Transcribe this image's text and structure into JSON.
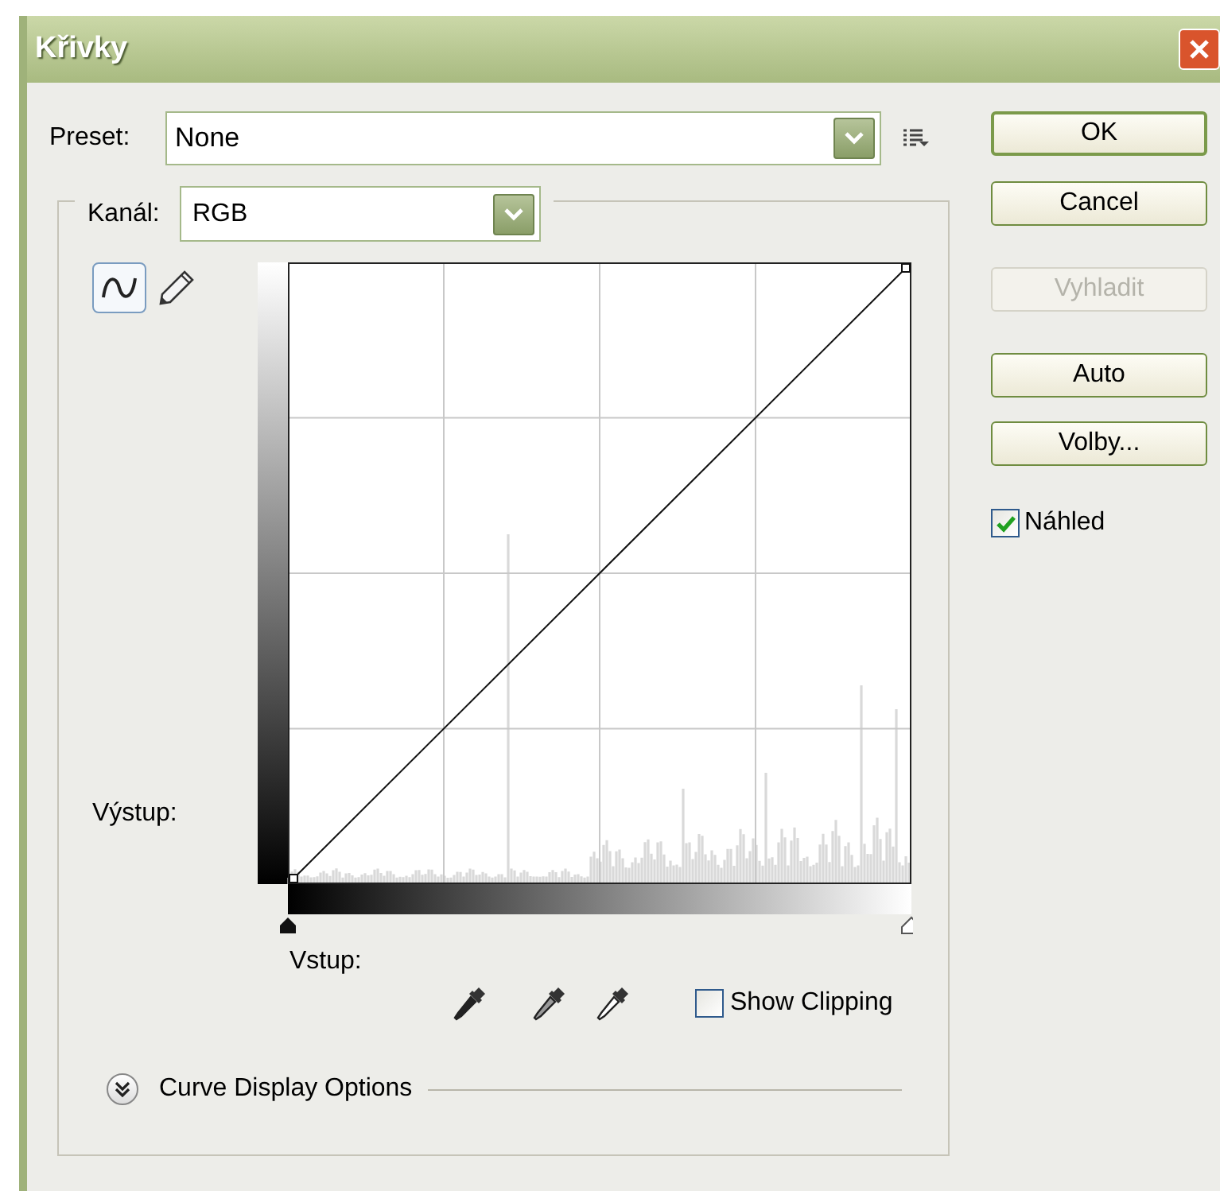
{
  "window": {
    "title": "Křivky"
  },
  "preset": {
    "label": "Preset:",
    "value": "None"
  },
  "buttons": [
    {
      "label": "OK",
      "disabled": false,
      "default": true
    },
    {
      "label": "Cancel",
      "disabled": false,
      "default": false
    },
    {
      "label": "Vyhladit",
      "disabled": true,
      "default": false
    },
    {
      "label": "Auto",
      "disabled": false,
      "default": false
    },
    {
      "label": "Volby...",
      "disabled": false,
      "default": false
    }
  ],
  "preview": {
    "label": "Náhled",
    "checked": true
  },
  "channel": {
    "label": "Kanál:",
    "value": "RGB"
  },
  "tools": [
    {
      "kind": "curve",
      "selected": true
    },
    {
      "kind": "pencil",
      "selected": false
    }
  ],
  "output_label": "Výstup:",
  "input_label": "Vstup:",
  "show_clipping": {
    "label": "Show Clipping",
    "checked": false
  },
  "curve_display_options": {
    "label": "Curve Display Options",
    "expanded": false
  }
}
